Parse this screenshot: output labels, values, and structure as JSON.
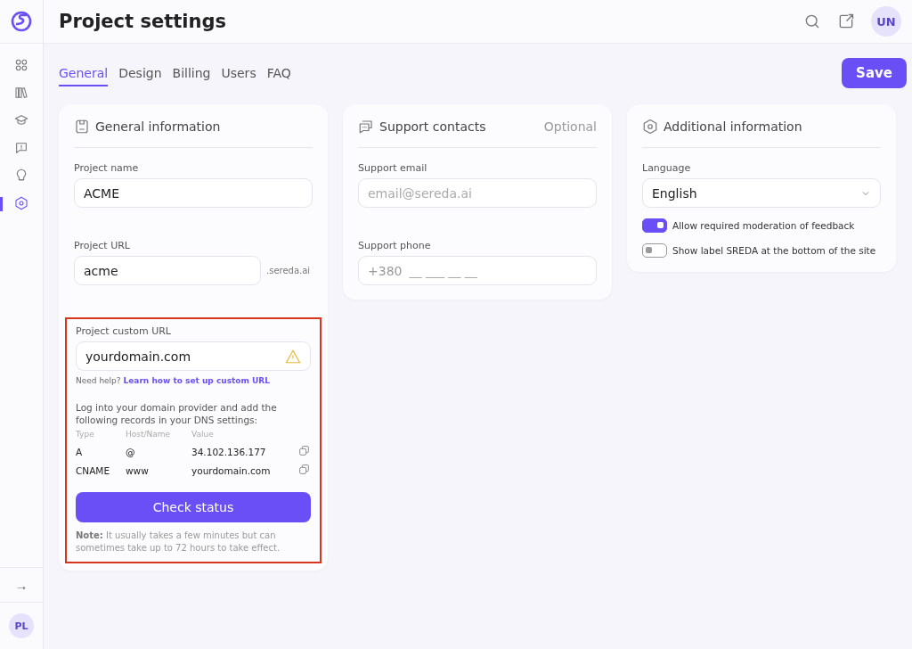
{
  "sidebar": {
    "items": [
      {
        "kind": "grid",
        "selected": false
      },
      {
        "kind": "books",
        "selected": false
      },
      {
        "kind": "cap",
        "selected": false
      },
      {
        "kind": "chat",
        "selected": false
      },
      {
        "kind": "bulb",
        "selected": false
      },
      {
        "kind": "gear",
        "selected": true
      }
    ],
    "collapse": "→",
    "avatar": "PL"
  },
  "header": {
    "title": "Project settings",
    "avatar": "UN"
  },
  "tabs": [
    {
      "label": "General",
      "selected": true
    },
    {
      "label": "Design",
      "selected": false
    },
    {
      "label": "Billing",
      "selected": false
    },
    {
      "label": "Users",
      "selected": false
    },
    {
      "label": "FAQ",
      "selected": false
    }
  ],
  "save_button": "Save",
  "general": {
    "title": "General information",
    "project_name": {
      "label": "Project name",
      "value": "ACME"
    },
    "project_url": {
      "label": "Project URL",
      "value": "acme",
      "suffix": ".sereda.ai"
    },
    "custom_url": {
      "highlighted": true,
      "label": "Project custom URL",
      "value": "yourdomain.com",
      "warning": true,
      "help": "Need help?",
      "help_link": "Learn how to set up custom URL",
      "instructions": "Log into your domain provider and add the following records in your DNS settings:",
      "columns": [
        "Type",
        "Host/Name",
        "Value"
      ],
      "records": [
        {
          "type": "A",
          "host": "@",
          "value": "34.102.136.177"
        },
        {
          "type": "CNAME",
          "host": "www",
          "value": "yourdomain.com"
        }
      ],
      "button": "Check status",
      "note": "**Note:** It usually takes a few minutes but can sometimes take up to 72 hours to take effect."
    }
  },
  "support": {
    "title": "Support contacts",
    "badge": "Optional",
    "email": {
      "label": "Support email",
      "placeholder": "email@sereda.ai"
    },
    "phone": {
      "label": "Support phone",
      "prefix": "+380",
      "placeholder": "__ ___ __ __"
    }
  },
  "additional": {
    "title": "Additional information",
    "language": {
      "label": "Language",
      "value": "English"
    },
    "toggles": [
      {
        "label": "Allow required moderation of feedback",
        "on": true
      },
      {
        "label": "Show label SREDA at the bottom of the site",
        "on": false
      }
    ]
  }
}
